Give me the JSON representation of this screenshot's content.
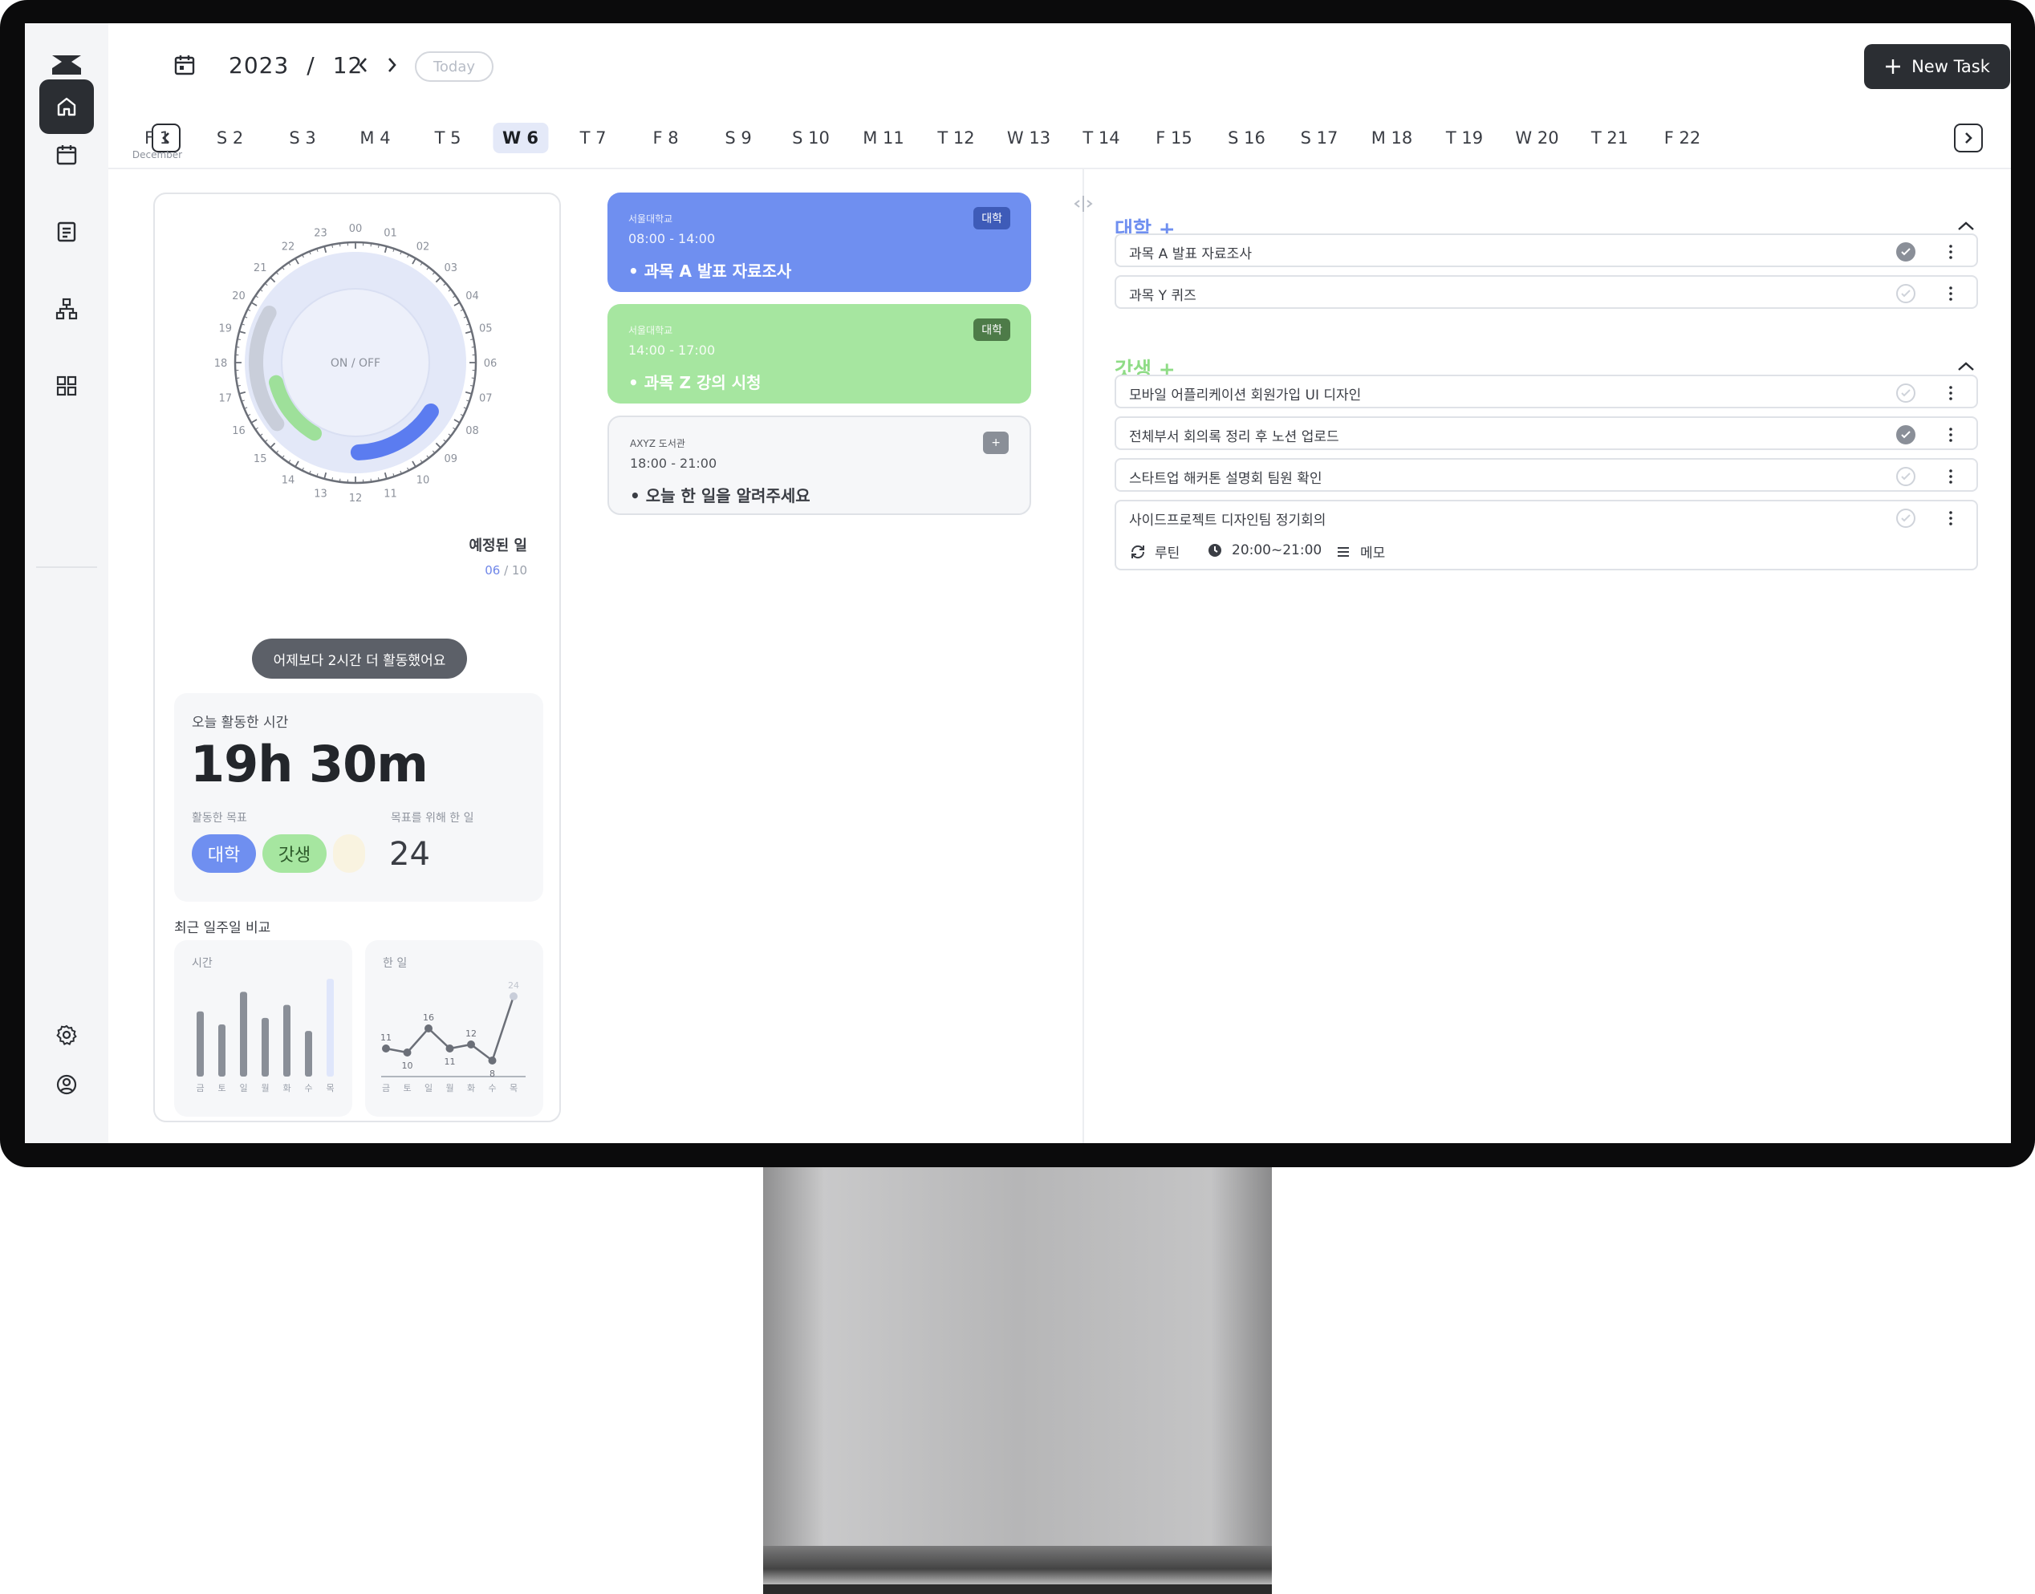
{
  "header": {
    "year": "2023",
    "separator": "/",
    "month": "12",
    "today_label": "Today",
    "new_task_label": "New Task"
  },
  "week": {
    "month_label": "December",
    "days": [
      {
        "label": "F 1",
        "active": false
      },
      {
        "label": "S 2",
        "active": false
      },
      {
        "label": "S 3",
        "active": false
      },
      {
        "label": "M 4",
        "active": false
      },
      {
        "label": "T 5",
        "active": false
      },
      {
        "label": "W 6",
        "active": true
      },
      {
        "label": "T 7",
        "active": false
      },
      {
        "label": "F 8",
        "active": false
      },
      {
        "label": "S 9",
        "active": false
      },
      {
        "label": "S 10",
        "active": false
      },
      {
        "label": "M 11",
        "active": false
      },
      {
        "label": "T 12",
        "active": false
      },
      {
        "label": "W 13",
        "active": false
      },
      {
        "label": "T 14",
        "active": false
      },
      {
        "label": "F 15",
        "active": false
      },
      {
        "label": "S 16",
        "active": false
      },
      {
        "label": "S 17",
        "active": false
      },
      {
        "label": "M 18",
        "active": false
      },
      {
        "label": "T 19",
        "active": false
      },
      {
        "label": "W 20",
        "active": false
      },
      {
        "label": "T 21",
        "active": false
      },
      {
        "label": "F 22",
        "active": false
      }
    ]
  },
  "sidebar": {
    "items": [
      {
        "icon": "home-icon",
        "active": true
      },
      {
        "icon": "calendar-icon",
        "active": false
      },
      {
        "icon": "document-icon",
        "active": false
      },
      {
        "icon": "hierarchy-icon",
        "active": false
      },
      {
        "icon": "grid-icon",
        "active": false
      }
    ],
    "bottom": [
      {
        "icon": "settings-icon"
      },
      {
        "icon": "profile-icon"
      }
    ]
  },
  "clock": {
    "center_label": "ON / OFF",
    "hours": [
      "00",
      "01",
      "02",
      "03",
      "04",
      "05",
      "06",
      "07",
      "08",
      "09",
      "10",
      "11",
      "12",
      "13",
      "14",
      "15",
      "16",
      "17",
      "18",
      "19",
      "20",
      "21",
      "22",
      "23"
    ],
    "planned_label": "예정된 일",
    "planned_done": "06",
    "planned_sep": " / ",
    "planned_total": "10"
  },
  "summary": {
    "compare_pill": "어제보다 2시간 더 활동했어요",
    "today_label": "오늘 활동한 시간",
    "today_value": "19h 30m",
    "goals_label": "활동한 목표",
    "tasks_label": "목표를 위해 한 일",
    "tasks_value": "24",
    "tags": [
      {
        "label": "대학",
        "bg": "#6f8ff0",
        "fg": "#ffffff"
      },
      {
        "label": "갓생",
        "bg": "#a6e6a0",
        "fg": "#2d5a2a"
      }
    ],
    "week_compare_label": "최근 일주일 비교"
  },
  "chart_data": [
    {
      "type": "bar",
      "title": "시간",
      "categories": [
        "금",
        "토",
        "일",
        "월",
        "화",
        "수",
        "목"
      ],
      "values": [
        5,
        4,
        6.5,
        4.5,
        5.5,
        3.5,
        7.5
      ]
    },
    {
      "type": "line",
      "title": "한 일",
      "categories": [
        "금",
        "토",
        "일",
        "월",
        "화",
        "수",
        "목"
      ],
      "values": [
        11,
        10,
        16,
        11,
        12,
        8,
        24
      ],
      "data_labels": [
        "11",
        "10",
        "16",
        "11",
        "12",
        "8",
        "24"
      ]
    }
  ],
  "schedule": [
    {
      "place": "서울대학교",
      "time": "08:00  -  14:00",
      "title": "과목 A 발표 자료조사",
      "badge": "대학",
      "bg": "#6f8ff0",
      "fg": "#ffffff",
      "badge_bg": "#3e5bb8"
    },
    {
      "place": "서울대학교",
      "time": "14:00  -  17:00",
      "title": "과목 Z 강의 시청",
      "badge": "대학",
      "bg": "#a6e6a0",
      "fg": "#ffffff",
      "badge_bg": "#4d7b48"
    },
    {
      "place": "AXYZ 도서관",
      "time": "18:00  -  21:00",
      "title": "오늘 한 일을 알려주세요",
      "badge": "+",
      "bg": "#f6f7f9",
      "fg": "#3a3d44",
      "badge_bg": "#8a8f98"
    }
  ],
  "groups": [
    {
      "title": "대학 +",
      "color": "#6f8ff0",
      "tasks": [
        {
          "label": "과목 A 발표 자료조사",
          "done": true
        },
        {
          "label": "과목 Y 퀴즈",
          "done": false
        }
      ]
    },
    {
      "title": "갓생 +",
      "color": "#8fdc86",
      "tasks": [
        {
          "label": "모바일 어플리케이션 회원가입 UI 디자인",
          "done": false
        },
        {
          "label": "전체부서 회의록 정리 후 노션 업로드",
          "done": true
        },
        {
          "label": "스타트업 해커톤 설명회 팀원 확인",
          "done": false
        },
        {
          "label": "사이드프로젝트 디자인팀 정기회의",
          "done": false
        }
      ]
    }
  ],
  "task_detail": {
    "routine_label": "루틴",
    "time_label": "20:00~21:00",
    "memo_label": "메모"
  }
}
